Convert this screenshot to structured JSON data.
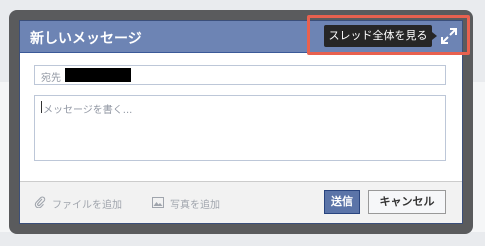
{
  "dialog": {
    "title": "新しいメッセージ",
    "tooltip": "スレッド全体を見る",
    "expand_icon": "expand-arrows-icon"
  },
  "to_field": {
    "label": "宛先"
  },
  "message_area": {
    "placeholder": "メッセージを書く..."
  },
  "footer": {
    "attach_file_label": "ファイルを追加",
    "attach_file_icon": "paperclip-icon",
    "add_photo_label": "写真を追加",
    "add_photo_icon": "photo-icon",
    "send_label": "送信",
    "cancel_label": "キャンセル"
  },
  "colors": {
    "header_bg": "#6d84b4",
    "highlight": "#e8614f",
    "send_bg": "#5b74a8"
  }
}
